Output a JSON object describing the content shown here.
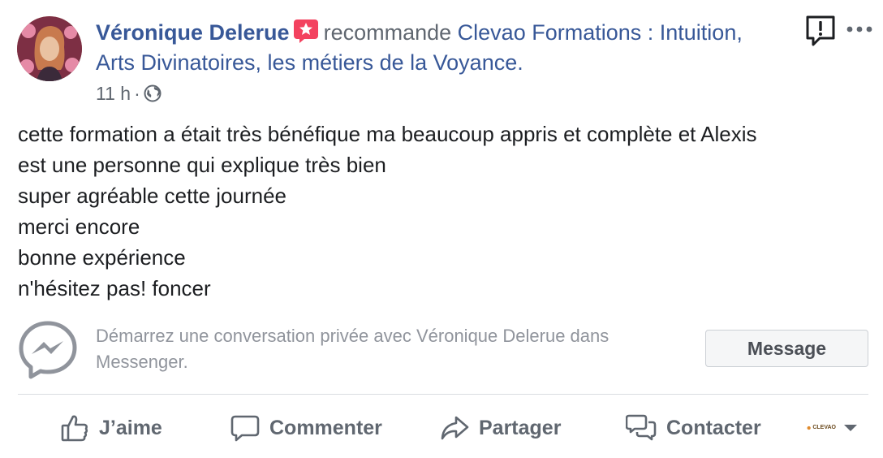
{
  "header": {
    "author_name": "Véronique Delerue",
    "action_text": "recommande",
    "page_name_line1": "Clevao Formations : Intuition,",
    "page_name_line2": "Arts Divinatoires, les métiers de la Voyance.",
    "timestamp": "11 h",
    "separator": "·",
    "audience_icon": "globe-icon",
    "badge_icon": "star-recommend-icon",
    "report_icon": "report-icon",
    "more_icon": "more-dots-icon"
  },
  "post": {
    "lines": [
      "cette formation a était très bénéfique ma beaucoup appris et complète et Alexis",
      "est une personne qui explique très bien",
      "super agréable cette journée",
      "merci encore",
      "bonne expérience",
      "n'hésitez pas! foncer"
    ]
  },
  "messenger": {
    "icon": "messenger-icon",
    "text_line1": "Démarrez une conversation privée avec Véronique Delerue dans",
    "text_line2": "Messenger.",
    "button_label": "Message"
  },
  "actions": {
    "like_label": "J’aime",
    "comment_label": "Commenter",
    "share_label": "Partager",
    "contact_label": "Contacter",
    "page_logo_text": "CLEVAO"
  },
  "colors": {
    "link_blue": "#385898",
    "secondary_text": "#606770",
    "badge_red": "#f3425f",
    "muted_text": "#90949c"
  }
}
